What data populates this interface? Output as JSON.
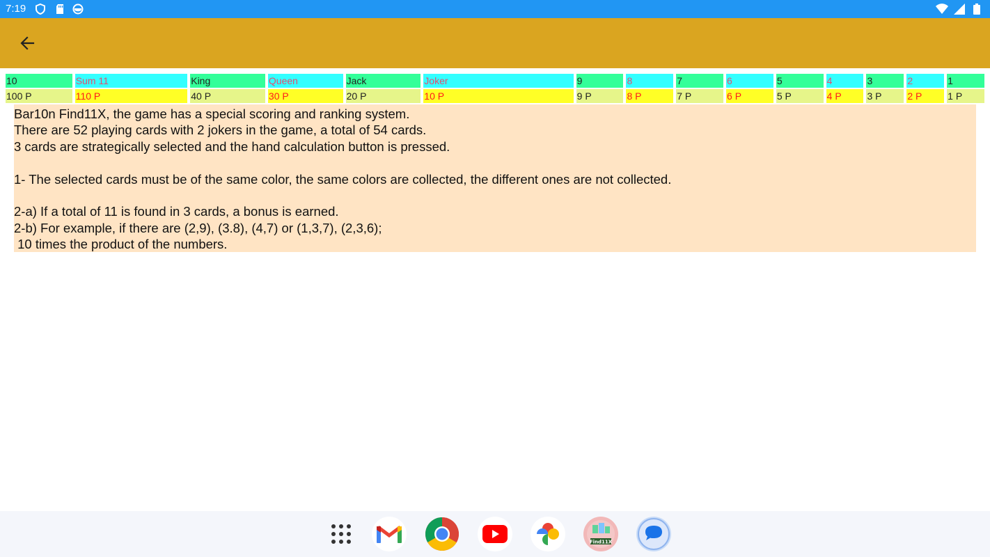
{
  "status_bar": {
    "time": "7:19",
    "icons_left": [
      "shield-icon",
      "sd-card-icon",
      "sync-icon"
    ],
    "icons_right": [
      "wifi-icon",
      "signal-icon",
      "battery-icon"
    ]
  },
  "app_bar": {
    "color": "#daa520",
    "back_icon": "arrow-back-icon"
  },
  "score_columns": [
    {
      "label": "10",
      "points": "100 P",
      "label_bg": "#33ff99",
      "points_bg": "#e6f58a",
      "style": "black"
    },
    {
      "label": "Sum 11",
      "points": "110 P",
      "label_bg": "#33ffff",
      "points_bg": "#ffff26",
      "style": "red"
    },
    {
      "label": "King",
      "points": "40 P",
      "label_bg": "#33ff99",
      "points_bg": "#e6f58a",
      "style": "black"
    },
    {
      "label": "Queen",
      "points": "30 P",
      "label_bg": "#33ffff",
      "points_bg": "#ffff26",
      "style": "red"
    },
    {
      "label": "Jack",
      "points": "20 P",
      "label_bg": "#33ff99",
      "points_bg": "#e6f58a",
      "style": "black"
    },
    {
      "label": "Joker",
      "points": "10 P",
      "label_bg": "#33ffff",
      "points_bg": "#ffff26",
      "style": "red"
    },
    {
      "label": "9",
      "points": "9 P",
      "label_bg": "#33ff99",
      "points_bg": "#e6f58a",
      "style": "black"
    },
    {
      "label": "8",
      "points": "8 P",
      "label_bg": "#33ffff",
      "points_bg": "#ffff26",
      "style": "red"
    },
    {
      "label": "7",
      "points": "7 P",
      "label_bg": "#33ff99",
      "points_bg": "#e6f58a",
      "style": "black"
    },
    {
      "label": "6",
      "points": "6 P",
      "label_bg": "#33ffff",
      "points_bg": "#ffff26",
      "style": "red"
    },
    {
      "label": "5",
      "points": "5 P",
      "label_bg": "#33ff99",
      "points_bg": "#e6f58a",
      "style": "black"
    },
    {
      "label": "4",
      "points": "4 P",
      "label_bg": "#33ffff",
      "points_bg": "#ffff26",
      "style": "red"
    },
    {
      "label": "3",
      "points": "3 P",
      "label_bg": "#33ff99",
      "points_bg": "#e6f58a",
      "style": "black"
    },
    {
      "label": "2",
      "points": "2 P",
      "label_bg": "#33ffff",
      "points_bg": "#ffff26",
      "style": "red"
    },
    {
      "label": "1",
      "points": "1 P",
      "label_bg": "#33ff99",
      "points_bg": "#e6f58a",
      "style": "black"
    }
  ],
  "info": {
    "background": "#ffe4c4",
    "text": "Bar10n Find11X, the game has a special scoring and ranking system.\nThere are 52 playing cards with 2 jokers in the game, a total of 54 cards.\n3 cards are strategically selected and the hand calculation button is pressed.\n\n1- The selected cards must be of the same color, the same colors are collected, the different ones are not collected.\n\n2-a) If a total of 11 is found in 3 cards, a bonus is earned.\n2-b) For example, if there are (2,9), (3.8), (4,7) or (1,3,7), (2,3,6);\n 10 times the product of the numbers."
  },
  "taskbar": {
    "apps": [
      {
        "name": "app-drawer-icon"
      },
      {
        "name": "gmail-icon"
      },
      {
        "name": "chrome-icon"
      },
      {
        "name": "youtube-icon"
      },
      {
        "name": "photos-icon"
      },
      {
        "name": "find11x-icon",
        "label": "Find11X"
      },
      {
        "name": "messages-icon"
      }
    ]
  }
}
